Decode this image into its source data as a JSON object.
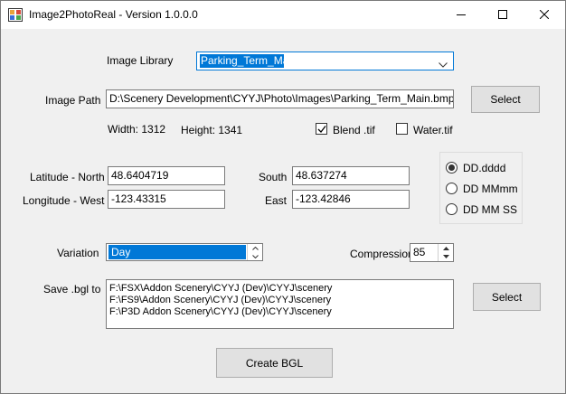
{
  "window": {
    "title": "Image2PhotoReal - Version 1.0.0.0"
  },
  "controls": {
    "minimize": "minimize-icon",
    "maximize": "maximize-icon",
    "close": "close-icon"
  },
  "image_library": {
    "label": "Image Library",
    "value": "Parking_Term_Main"
  },
  "image_path": {
    "label": "Image Path",
    "value": "D:\\Scenery Development\\CYYJ\\Photo\\Images\\Parking_Term_Main.bmp",
    "select_label": "Select"
  },
  "dimensions": {
    "width": "Width: 1312",
    "height": "Height: 1341"
  },
  "blend": {
    "label": "Blend .tif",
    "checked": true
  },
  "water": {
    "label": "Water.tif",
    "checked": false
  },
  "coords": {
    "lat_north_label": "Latitude - North",
    "lat_north": "48.6404719",
    "south_label": "South",
    "south": "48.637274",
    "lon_west_label": "Longitude - West",
    "lon_west": "-123.43315",
    "east_label": "East",
    "east": "-123.42846"
  },
  "format": {
    "options": [
      "DD.dddd",
      "DD MMmm",
      "DD MM SS"
    ],
    "selected": "DD.dddd"
  },
  "variation": {
    "label": "Variation",
    "value": "Day"
  },
  "compression": {
    "label": "Compression",
    "value": "85"
  },
  "save": {
    "label": "Save .bgl to",
    "paths": [
      "F:\\FSX\\Addon Scenery\\CYYJ (Dev)\\CYYJ\\scenery",
      "F:\\FS9\\Addon Scenery\\CYYJ (Dev)\\CYYJ\\scenery",
      "F:\\P3D Addon Scenery\\CYYJ (Dev)\\CYYJ\\scenery"
    ],
    "select_label": "Select"
  },
  "create_button": "Create BGL"
}
